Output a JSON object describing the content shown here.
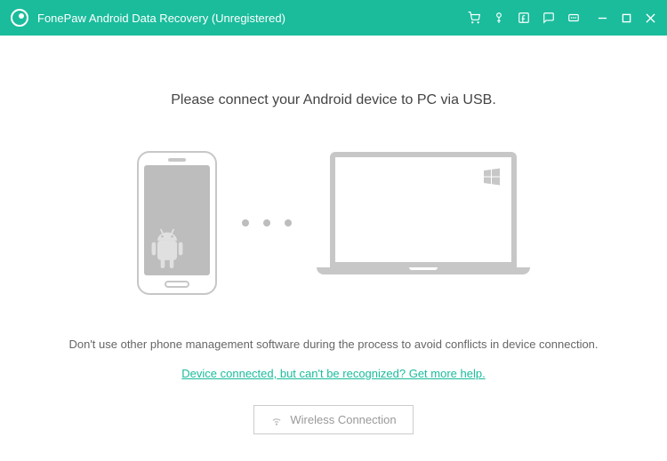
{
  "titlebar": {
    "title": "FonePaw Android Data Recovery (Unregistered)"
  },
  "main": {
    "heading": "Please connect your Android device to PC via USB.",
    "warning": "Don't use other phone management software during the process to avoid conflicts in device connection.",
    "help_link": "Device connected, but can't be recognized? Get more help.",
    "wireless_label": "Wireless Connection"
  }
}
